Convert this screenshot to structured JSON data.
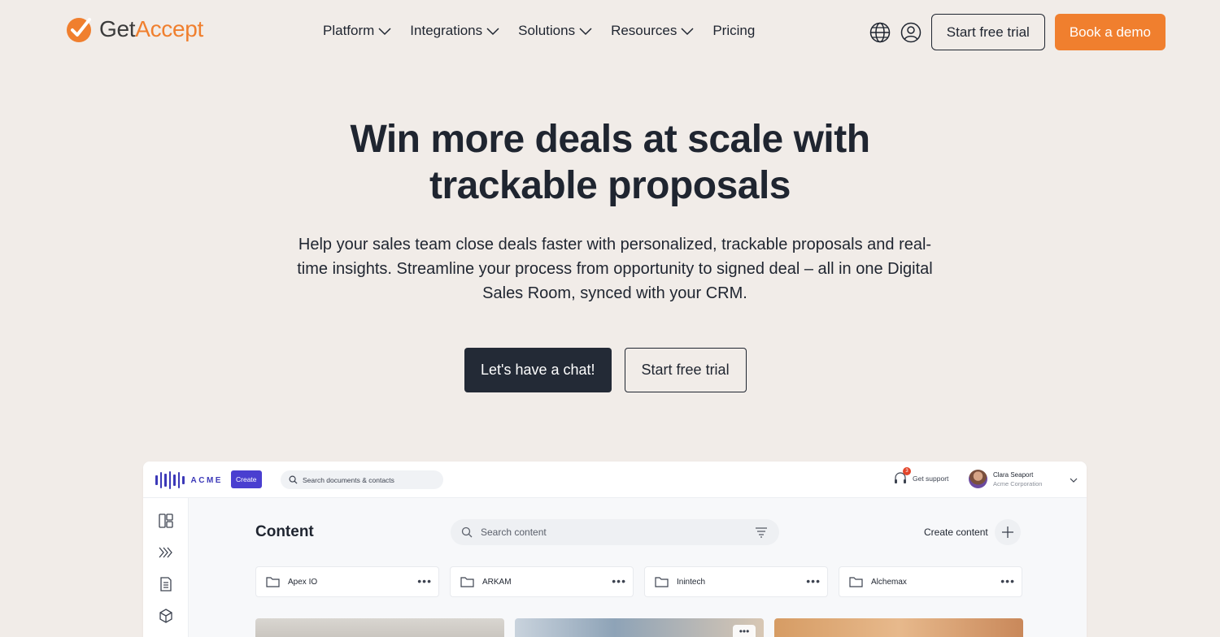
{
  "brand": {
    "get": "Get",
    "accept": "Accept",
    "accent": "#f07f2e",
    "dark": "#232a36"
  },
  "nav": {
    "items": [
      {
        "label": "Platform",
        "has_dropdown": true
      },
      {
        "label": "Integrations",
        "has_dropdown": true
      },
      {
        "label": "Solutions",
        "has_dropdown": true
      },
      {
        "label": "Resources",
        "has_dropdown": true
      },
      {
        "label": "Pricing",
        "has_dropdown": false
      }
    ]
  },
  "header_actions": {
    "globe_icon": "globe-icon",
    "user_icon": "user-icon",
    "trial_label": "Start free trial",
    "demo_label": "Book a demo"
  },
  "hero": {
    "title_line1": "Win more deals at scale with",
    "title_line2": "trackable proposals",
    "subtitle": "Help your sales team close deals faster with personalized, trackable proposals and real-time insights. Streamline your process from opportunity to signed deal – all in one Digital Sales Room, synced with your CRM.",
    "chat_label": "Let's have a chat!",
    "trial_label": "Start free trial"
  },
  "app": {
    "logo_text": "ACME",
    "create_label": "Create",
    "search_placeholder": "Search documents & contacts",
    "support_label": "Get support",
    "support_badge": "3",
    "user_name": "Clara Seaport",
    "user_org": "Acme Corporation",
    "sidebar_icons": [
      "dashboard-icon",
      "pipeline-icon",
      "document-icon",
      "box-icon"
    ],
    "content_title": "Content",
    "content_search_placeholder": "Search content",
    "create_content_label": "Create content",
    "folders": [
      {
        "name": "Apex IO"
      },
      {
        "name": "ARKAM"
      },
      {
        "name": "Inintech"
      },
      {
        "name": "Alchemax"
      }
    ]
  }
}
